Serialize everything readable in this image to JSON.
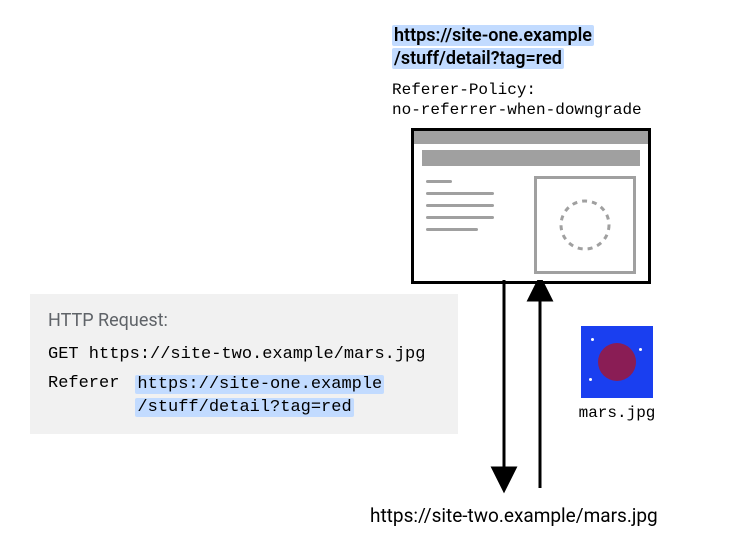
{
  "top_url_line1": "https://site-one.example",
  "top_url_line2": "/stuff/detail?tag=red",
  "policy_line1": "Referer-Policy:",
  "policy_line2": "no-referrer-when-downgrade",
  "http_box": {
    "title": "HTTP Request:",
    "method_line": "GET https://site-two.example/mars.jpg",
    "referer_label": "Referer",
    "referer_value_line1": "https://site-one.example",
    "referer_value_line2": "/stuff/detail?tag=red"
  },
  "mars_caption": "mars.jpg",
  "bottom_url": "https://site-two.example/mars.jpg"
}
